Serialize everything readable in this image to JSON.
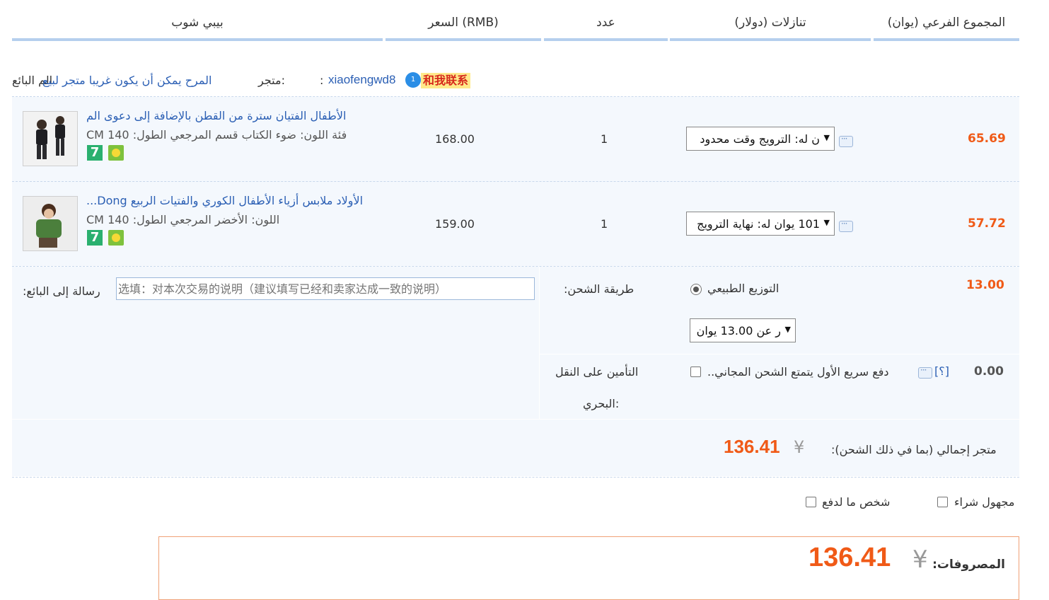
{
  "header": {
    "col_shop": "بيبي شوب",
    "col_price": "السعر (RMB)",
    "col_qty": "عدد",
    "col_discount": "(تنازلات (دولار",
    "col_subtotal": "(المجموع الفرعي (يوان"
  },
  "store": {
    "seller_prefix": "الم البائع",
    "shop_name": "المرح يمكن أن يكون غريبا متجر لبيع",
    "shop_label": "متجر:",
    "seller_id_label": ":",
    "seller_id": "xiaofengwd8",
    "contact_label": "和我联系"
  },
  "items": [
    {
      "title": "الأطفال الفتيان سترة من القطن بالإضافة إلى دعوى الم",
      "attrs": "CM فئة اللون: ضوء الكتاب قسم المرجعي الطول: 140",
      "price": "168.00",
      "qty": "1",
      "promo": "ن له: الترويج وقت محدود",
      "subtotal": "65.69"
    },
    {
      "title": "...Dong الأولاد ملابس أزياء الأطفال الكوري والفتيات الربيع",
      "attrs": "CM اللون: الأخضر المرجعي الطول: 140",
      "price": "159.00",
      "qty": "1",
      "promo": "101 يوان له: نهاية الترويج",
      "subtotal": "57.72"
    }
  ],
  "badges": {
    "seven": "7"
  },
  "message": {
    "label": "رسالة إلى البائع:",
    "placeholder": "选填：对本次交易的说明（建议填写已经和卖家达成一致的说明）"
  },
  "shipping": {
    "label": "طريقة الشحن:",
    "method": "التوزيع الطبيعي",
    "fee_select": "ر عن 13.00 يوان",
    "cost": "13.00"
  },
  "insurance": {
    "label_line1": "التأمين على النقل",
    "label_line2": "البحري:",
    "option": "..دفع سريع الأول يتمتع الشحن المجاني",
    "help": "[؟]",
    "cost": "0.00"
  },
  "store_total": {
    "label": "متجر إجمالي (بما في ذلك الشحن):",
    "currency": "¥",
    "amount": "136.41"
  },
  "options": {
    "anonymous": "مجهول شراء",
    "pay_for_me": "شخص ما لدفع"
  },
  "grand_total": {
    "label": "المصروفات:",
    "currency": "¥",
    "amount": "136.41"
  },
  "colors": {
    "accent_orange": "#f05a17",
    "link_blue": "#2b5fb4",
    "header_rule": "#b5cfee",
    "row_bg": "#f4f8fd"
  }
}
